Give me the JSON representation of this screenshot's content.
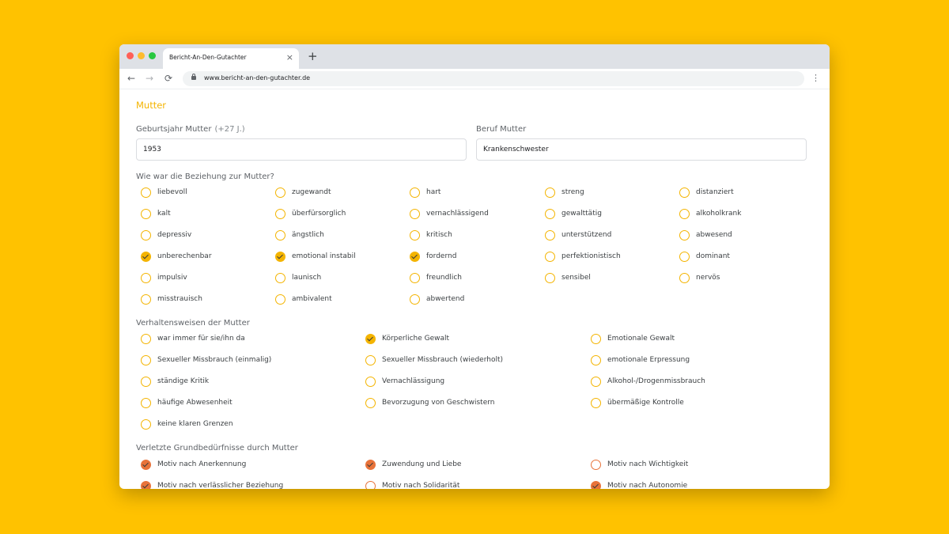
{
  "browser": {
    "tab_title": "Bericht-An-Den-Gutachter",
    "tab_close": "×",
    "new_tab": "+",
    "url": "www.bericht-an-den-gutachter.de",
    "back": "←",
    "forward": "→",
    "reload": "⟳",
    "menu": "⋮"
  },
  "form": {
    "section_title": "Mutter",
    "birth_year": {
      "label": "Geburtsjahr Mutter",
      "hint": "(+27 J.)",
      "value": "1953"
    },
    "job": {
      "label": "Beruf Mutter",
      "value": "Krankenschwester"
    },
    "relationship": {
      "label": "Wie war die Beziehung zur Mutter?",
      "options": [
        {
          "label": "liebevoll",
          "checked": false
        },
        {
          "label": "zugewandt",
          "checked": false
        },
        {
          "label": "hart",
          "checked": false
        },
        {
          "label": "streng",
          "checked": false
        },
        {
          "label": "distanziert",
          "checked": false
        },
        {
          "label": "kalt",
          "checked": false
        },
        {
          "label": "überfürsorglich",
          "checked": false
        },
        {
          "label": "vernachlässigend",
          "checked": false
        },
        {
          "label": "gewalttätig",
          "checked": false
        },
        {
          "label": "alkoholkrank",
          "checked": false
        },
        {
          "label": "depressiv",
          "checked": false
        },
        {
          "label": "ängstlich",
          "checked": false
        },
        {
          "label": "kritisch",
          "checked": false
        },
        {
          "label": "unterstützend",
          "checked": false
        },
        {
          "label": "abwesend",
          "checked": false
        },
        {
          "label": "unberechenbar",
          "checked": true
        },
        {
          "label": "emotional instabil",
          "checked": true
        },
        {
          "label": "fordernd",
          "checked": true
        },
        {
          "label": "perfektionistisch",
          "checked": false
        },
        {
          "label": "dominant",
          "checked": false
        },
        {
          "label": "impulsiv",
          "checked": false
        },
        {
          "label": "launisch",
          "checked": false
        },
        {
          "label": "freundlich",
          "checked": false
        },
        {
          "label": "sensibel",
          "checked": false
        },
        {
          "label": "nervös",
          "checked": false
        },
        {
          "label": "misstrauisch",
          "checked": false
        },
        {
          "label": "ambivalent",
          "checked": false
        },
        {
          "label": "abwertend",
          "checked": false
        }
      ]
    },
    "behaviors": {
      "label": "Verhaltensweisen der Mutter",
      "options": [
        {
          "label": "war immer für sie/ihn da",
          "checked": false
        },
        {
          "label": "Körperliche Gewalt",
          "checked": true
        },
        {
          "label": "Emotionale Gewalt",
          "checked": false
        },
        {
          "label": "Sexueller Missbrauch (einmalig)",
          "checked": false
        },
        {
          "label": "Sexueller Missbrauch (wiederholt)",
          "checked": false
        },
        {
          "label": "emotionale Erpressung",
          "checked": false
        },
        {
          "label": "ständige Kritik",
          "checked": false
        },
        {
          "label": "Vernachlässigung",
          "checked": false
        },
        {
          "label": "Alkohol-/Drogenmissbrauch",
          "checked": false
        },
        {
          "label": "häufige Abwesenheit",
          "checked": false
        },
        {
          "label": "Bevorzugung von Geschwistern",
          "checked": false
        },
        {
          "label": "übermäßige Kontrolle",
          "checked": false
        },
        {
          "label": "keine klaren Grenzen",
          "checked": false
        }
      ]
    },
    "needs": {
      "label": "Verletzte Grundbedürfnisse durch Mutter",
      "options": [
        {
          "label": "Motiv nach Anerkennung",
          "checked": true
        },
        {
          "label": "Zuwendung und Liebe",
          "checked": true
        },
        {
          "label": "Motiv nach Wichtigkeit",
          "checked": false
        },
        {
          "label": "Motiv nach verlässlicher Beziehung",
          "checked": true
        },
        {
          "label": "Motiv nach Solidarität",
          "checked": false
        },
        {
          "label": "Motiv nach Autonomie",
          "checked": true
        }
      ]
    }
  },
  "colors": {
    "background": "#ffc200",
    "accent_yellow": "#f4b400",
    "accent_orange": "#e8733a"
  }
}
